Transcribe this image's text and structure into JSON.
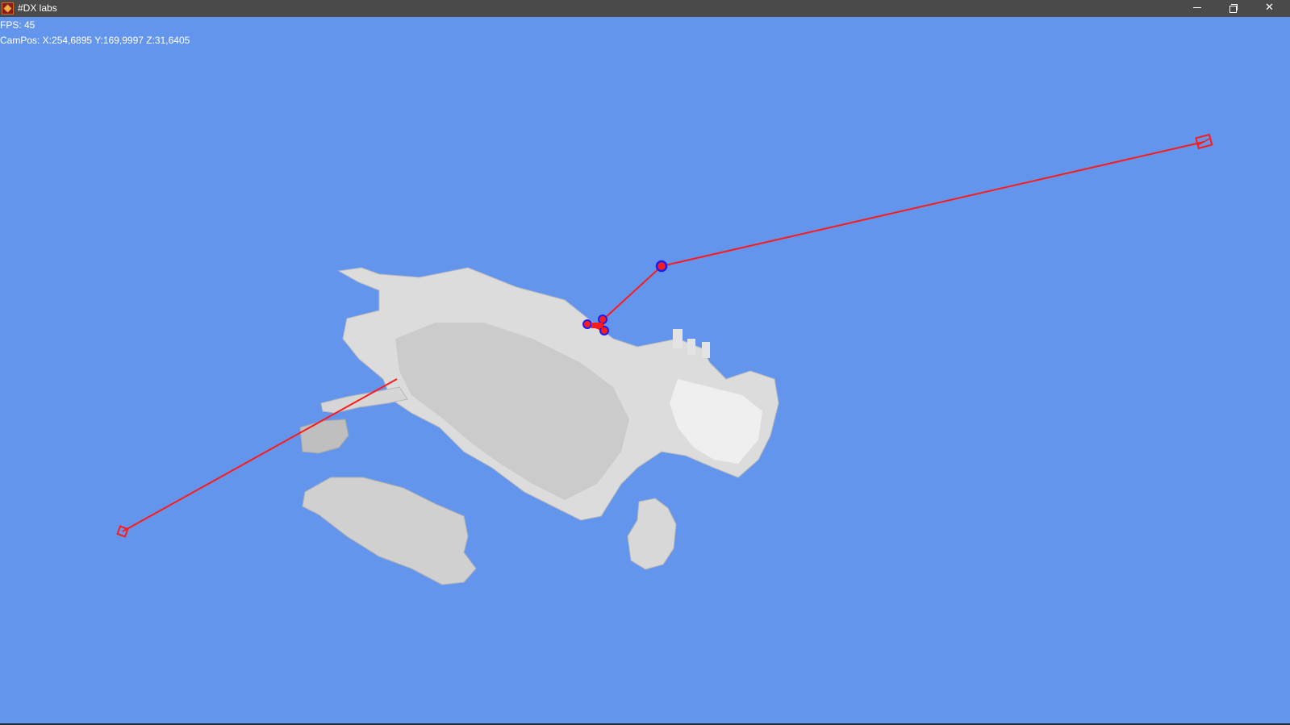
{
  "window": {
    "title": "#DX labs",
    "background_color": "#6495ed",
    "titlebar_color": "#4a4a4a",
    "controls": {
      "minimize": "minimize-icon",
      "maximize": "restore-icon",
      "close": "close-icon",
      "close_glyph": "✕"
    }
  },
  "hud": {
    "fps": "FPS: 45",
    "campos": "CamPos: X:254,6895 Y:169,9997 Z:31,6405"
  },
  "scene": {
    "voxel_color": "#e6e6e6",
    "path_color": "#ff1a1a",
    "waypoint_color": "#1a1aff"
  }
}
